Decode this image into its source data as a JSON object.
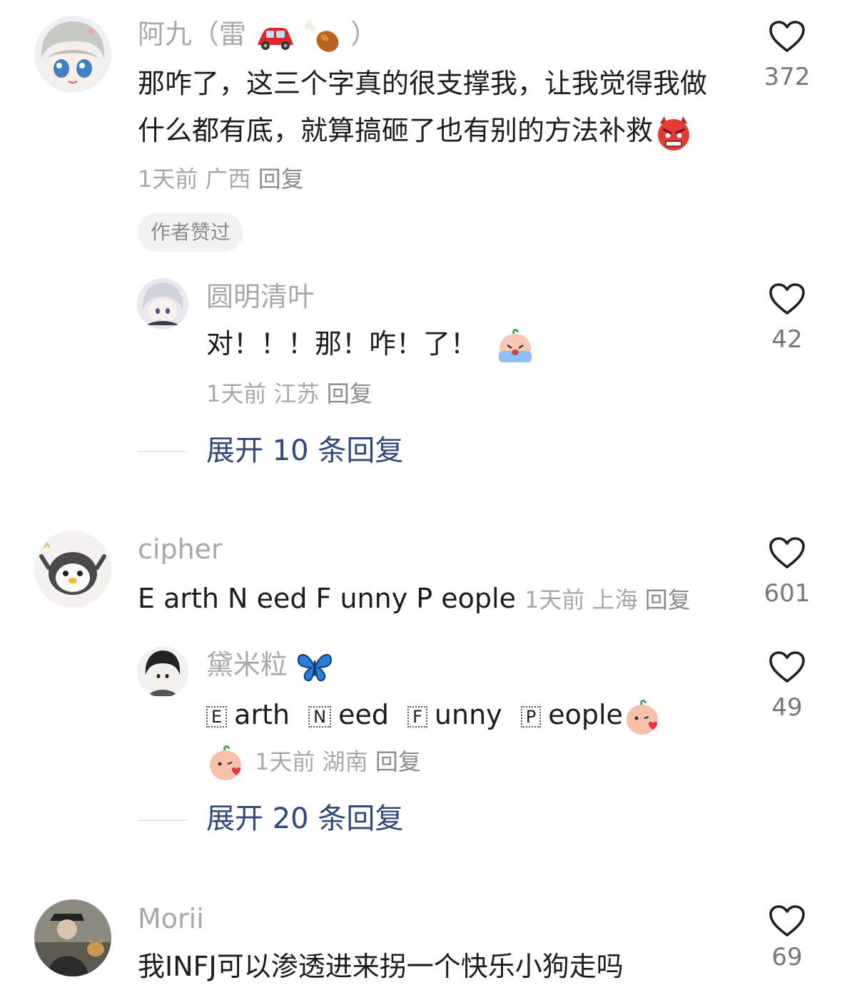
{
  "colors": {
    "username": "#a8a8a8",
    "meta": "#a8a8a8",
    "link": "#2f4a7a",
    "badge_bg": "#f2f2f2",
    "text": "#1c1c1c"
  },
  "comments": [
    {
      "username": "阿九（雷",
      "username_suffix": "）",
      "username_emojis": [
        "car-emoji",
        "drumstick-emoji"
      ],
      "text": "那咋了，这三个字真的很支撑我，让我觉得我做什么都有底，就算搞砸了也有别的方法补救",
      "text_emoji": "angry-devil-emoji",
      "time": "1天前",
      "location": "广西",
      "reply_label": "回复",
      "badge": "作者赞过",
      "likes": "372",
      "like_icon": "heart-outline-icon",
      "replies": [
        {
          "username": "圆明清叶",
          "text": "对！！！那！咋！了！",
          "text_emoji": "crying-emoji",
          "time": "1天前",
          "location": "江苏",
          "reply_label": "回复",
          "likes": "42"
        }
      ],
      "expand_label": "展开 10 条回复"
    },
    {
      "username": "cipher",
      "text": "E arth N eed F unny P eople",
      "time": "1天前",
      "location": "上海",
      "reply_label": "回复",
      "likes": "601",
      "replies": [
        {
          "username": "黛米粒",
          "username_emoji": "butterfly-emoji",
          "boxed_letters": [
            "E",
            "N",
            "F",
            "P"
          ],
          "words": [
            "arth",
            "eed",
            "unny",
            "eople"
          ],
          "text_emoji": "blowing-kiss-emoji",
          "time": "1天前",
          "location": "湖南",
          "reply_label": "回复",
          "likes": "49"
        }
      ],
      "expand_label": "展开 20 条回复"
    },
    {
      "username": "Morii",
      "text": "我INFJ可以渗透进来拐一个快乐小狗走吗",
      "likes": "69"
    }
  ]
}
